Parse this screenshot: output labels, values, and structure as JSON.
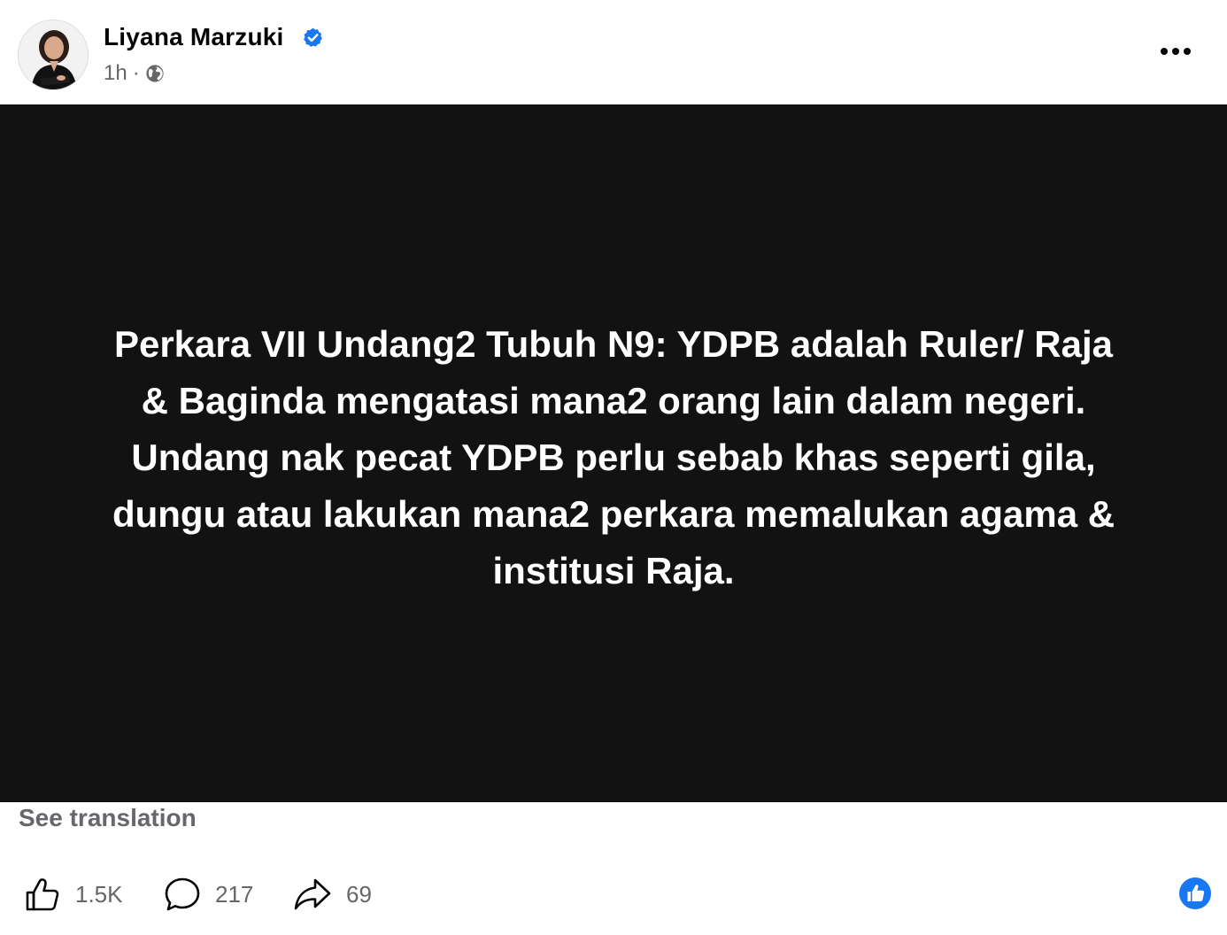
{
  "author": {
    "name": "Liyana Marzuki",
    "verified_icon": "verified-badge-icon",
    "avatar_icon": "profile-avatar"
  },
  "meta": {
    "time": "1h",
    "separator": "·",
    "audience_icon": "globe-icon"
  },
  "menu": {
    "icon": "more-options-icon"
  },
  "post": {
    "background": "#121212",
    "text_color": "#ffffff",
    "lines": [
      "Perkara VII Undang2 Tubuh N9: YDPB adalah Ruler/ Raja",
      "& Baginda mengatasi mana2 orang lain dalam negeri.",
      "Undang nak pecat YDPB perlu sebab khas seperti gila,",
      "dungu atau lakukan mana2 perkara memalukan agama &",
      "institusi Raja."
    ]
  },
  "see_translation": "See translation",
  "actions": {
    "like": {
      "icon": "thumbs-up-icon",
      "count": "1.5K"
    },
    "comment": {
      "icon": "comment-icon",
      "count": "217"
    },
    "share": {
      "icon": "share-icon",
      "count": "69"
    }
  },
  "reaction_summary": {
    "icon": "like-reaction-icon",
    "color": "#1877f2"
  },
  "colors": {
    "secondary_text": "#65676b",
    "verified_blue": "#1877f2"
  }
}
